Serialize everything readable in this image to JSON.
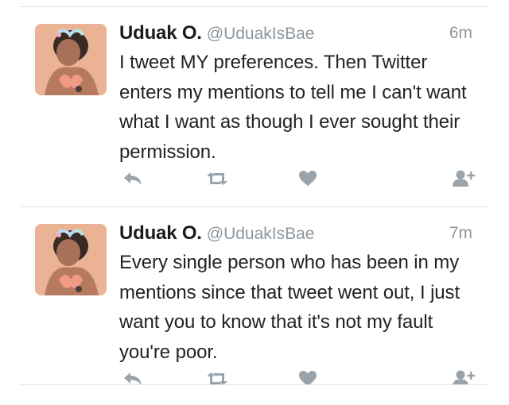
{
  "tweets": [
    {
      "name": "Uduak O.",
      "handle": "@UduakIsBae",
      "time": "6m",
      "text": "I tweet MY preferences. Then Twitter enters my mentions to tell me I can't want what I want as though I ever sought their permission."
    },
    {
      "name": "Uduak O.",
      "handle": "@UduakIsBae",
      "time": "7m",
      "text": "Every single person who has been in my mentions since that tweet went out, I just want you to know that it's not my fault you're poor."
    }
  ],
  "icons": {
    "reply": "reply-icon",
    "retweet": "retweet-icon",
    "like": "heart-icon",
    "follow": "follow-icon"
  },
  "colors": {
    "icon_gray": "#9aa3aa",
    "meta_gray": "#8e979e",
    "text": "#232323"
  }
}
